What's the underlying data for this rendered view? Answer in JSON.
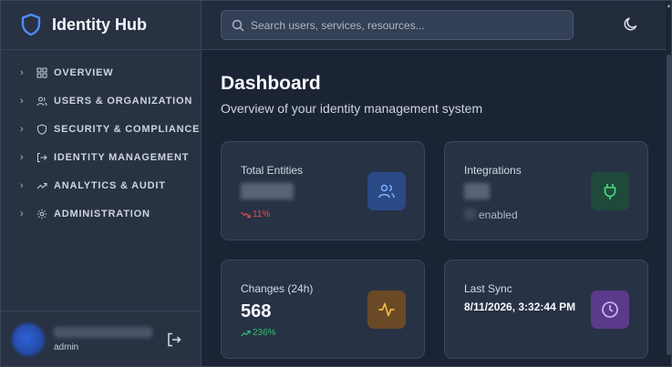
{
  "app": {
    "title": "Identity Hub"
  },
  "sidebar": {
    "items": [
      {
        "label": "OVERVIEW",
        "icon": "dashboard-icon"
      },
      {
        "label": "USERS & ORGANIZATION",
        "icon": "users-icon"
      },
      {
        "label": "SECURITY & COMPLIANCE",
        "icon": "shield-icon"
      },
      {
        "label": "IDENTITY MANAGEMENT",
        "icon": "login-icon"
      },
      {
        "label": "ANALYTICS & AUDIT",
        "icon": "trending-icon"
      },
      {
        "label": "ADMINISTRATION",
        "icon": "gear-icon"
      }
    ],
    "user": {
      "role": "admin"
    }
  },
  "header": {
    "search_placeholder": "Search users, services, resources...",
    "theme_icon": "moon-icon"
  },
  "main": {
    "title": "Dashboard",
    "subtitle": "Overview of your identity management system",
    "cards": {
      "total_entities": {
        "label": "Total Entities",
        "trend": "11%",
        "trend_dir": "down",
        "icon": "users-icon",
        "icon_bg": "#2a4a86",
        "icon_color": "#7fb0ff"
      },
      "integrations": {
        "label": "Integrations",
        "suffix": "enabled",
        "icon": "plug-icon",
        "icon_bg": "#1f4a3b",
        "icon_color": "#4ade80"
      },
      "changes": {
        "label": "Changes (24h)",
        "value": "568",
        "trend": "236%",
        "trend_dir": "up",
        "icon": "activity-icon",
        "icon_bg": "#6a4a26",
        "icon_color": "#f5b942"
      },
      "last_sync": {
        "label": "Last Sync",
        "value": "8/11/2026, 3:32:44 PM",
        "icon": "clock-icon",
        "icon_bg": "#5b3a8c",
        "icon_color": "#d6b8ff"
      }
    }
  },
  "colors": {
    "background": "#1b2435",
    "sidebar": "#283243",
    "card": "#283245",
    "trend_down": "#e0524f",
    "trend_up": "#2fbf71"
  }
}
